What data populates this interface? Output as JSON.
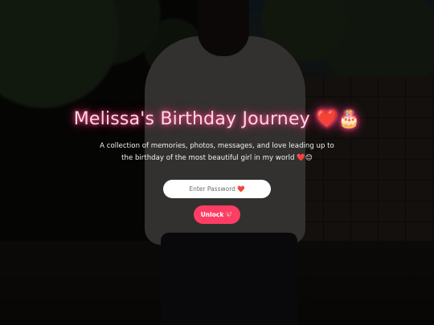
{
  "hero": {
    "title": "Melissa's Birthday Journey ❤️🎂",
    "subtitle": "A collection of memories, photos, messages, and love leading up to the birthday of the most beautiful girl in my world ❤️😊"
  },
  "auth": {
    "password_placeholder": "Enter Password ❤️",
    "password_value": "",
    "unlock_label": "Unlock 💖"
  },
  "colors": {
    "accent": "#ff3d64",
    "title_glow": "#ff4f8b"
  }
}
